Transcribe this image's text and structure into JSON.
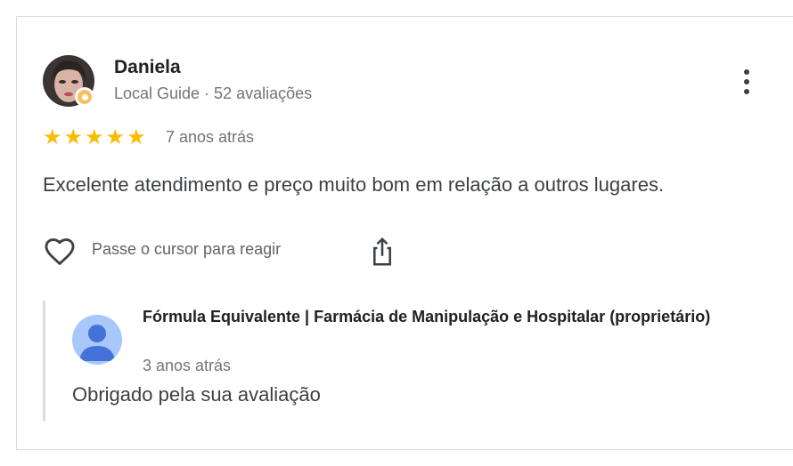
{
  "review": {
    "author": "Daniela",
    "author_meta": "Local Guide · 52 avaliações",
    "rating": 5,
    "stars": [
      "★",
      "★",
      "★",
      "★",
      "★"
    ],
    "time_ago": "7 anos atrás",
    "text": "Excelente atendimento e preço muito bom em relação a outros lugares.",
    "react_label": "Passe o cursor para reagir"
  },
  "owner_reply": {
    "name": "Fórmula Equivalente | Farmácia de Manipulação e Hospitalar (proprietário)",
    "time_ago": "3 anos atrás",
    "text": "Obrigado pela sua avaliação"
  },
  "icons": {
    "more": "more-vert-icon",
    "react": "heart-outline-icon",
    "share": "share-icon",
    "badge": "local-guide-badge-icon"
  },
  "colors": {
    "star": "#fbbc04",
    "owner_avatar_bg": "#a8c7fa",
    "owner_avatar_fg": "#4472d9"
  }
}
